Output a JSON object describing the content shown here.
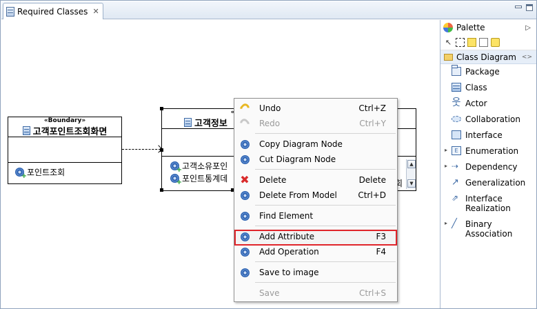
{
  "editor": {
    "tab_title": "Required Classes",
    "tab_close": "✕"
  },
  "diagram": {
    "boundary_class": {
      "stereotype": "«Boundary»",
      "name": "고객포인트조회화면",
      "operations": [
        "포인트조회"
      ]
    },
    "control_class": {
      "stereotype": "«Control»",
      "name": "고객정보",
      "operations": [
        "고객소유포인",
        "포인트통계데"
      ],
      "overflow_text": "회"
    }
  },
  "context_menu": {
    "items": [
      {
        "label": "Undo",
        "accel": "Ctrl+Z",
        "enabled": true,
        "icon": "undo-icon"
      },
      {
        "label": "Redo",
        "accel": "Ctrl+Y",
        "enabled": false,
        "icon": "redo-icon"
      },
      {
        "label": "Copy Diagram Node",
        "accel": "",
        "enabled": true,
        "icon": "gear-icon"
      },
      {
        "label": "Cut Diagram Node",
        "accel": "",
        "enabled": true,
        "icon": "gear-icon"
      },
      {
        "label": "Delete",
        "accel": "Delete",
        "enabled": true,
        "icon": "delete-icon"
      },
      {
        "label": "Delete From Model",
        "accel": "Ctrl+D",
        "enabled": true,
        "icon": "gear-icon"
      },
      {
        "label": "Find Element",
        "accel": "",
        "enabled": true,
        "icon": "gear-icon"
      },
      {
        "label": "Add Attribute",
        "accel": "F3",
        "enabled": true,
        "icon": "gear-icon",
        "highlighted": true
      },
      {
        "label": "Add Operation",
        "accel": "F4",
        "enabled": true,
        "icon": "gear-icon"
      },
      {
        "label": "Save to image",
        "accel": "",
        "enabled": true,
        "icon": "gear-icon"
      },
      {
        "label": "Save",
        "accel": "Ctrl+S",
        "enabled": false,
        "icon": ""
      }
    ],
    "highlight_color": "#e0242a"
  },
  "palette": {
    "title": "Palette",
    "drawer": "Class Diagram",
    "items": [
      {
        "label": "Package",
        "icon": "package-icon"
      },
      {
        "label": "Class",
        "icon": "class-icon"
      },
      {
        "label": "Actor",
        "icon": "actor-icon"
      },
      {
        "label": "Collaboration",
        "icon": "collaboration-icon"
      },
      {
        "label": "Interface",
        "icon": "interface-icon"
      },
      {
        "label": "Enumeration",
        "icon": "enumeration-icon",
        "expandable": true
      },
      {
        "label": "Dependency",
        "icon": "dependency-icon",
        "expandable": true
      },
      {
        "label": "Generalization",
        "icon": "generalization-icon"
      },
      {
        "label": "Interface Realization",
        "icon": "realization-icon"
      },
      {
        "label": "Binary Association",
        "icon": "association-icon",
        "expandable": true
      }
    ]
  }
}
